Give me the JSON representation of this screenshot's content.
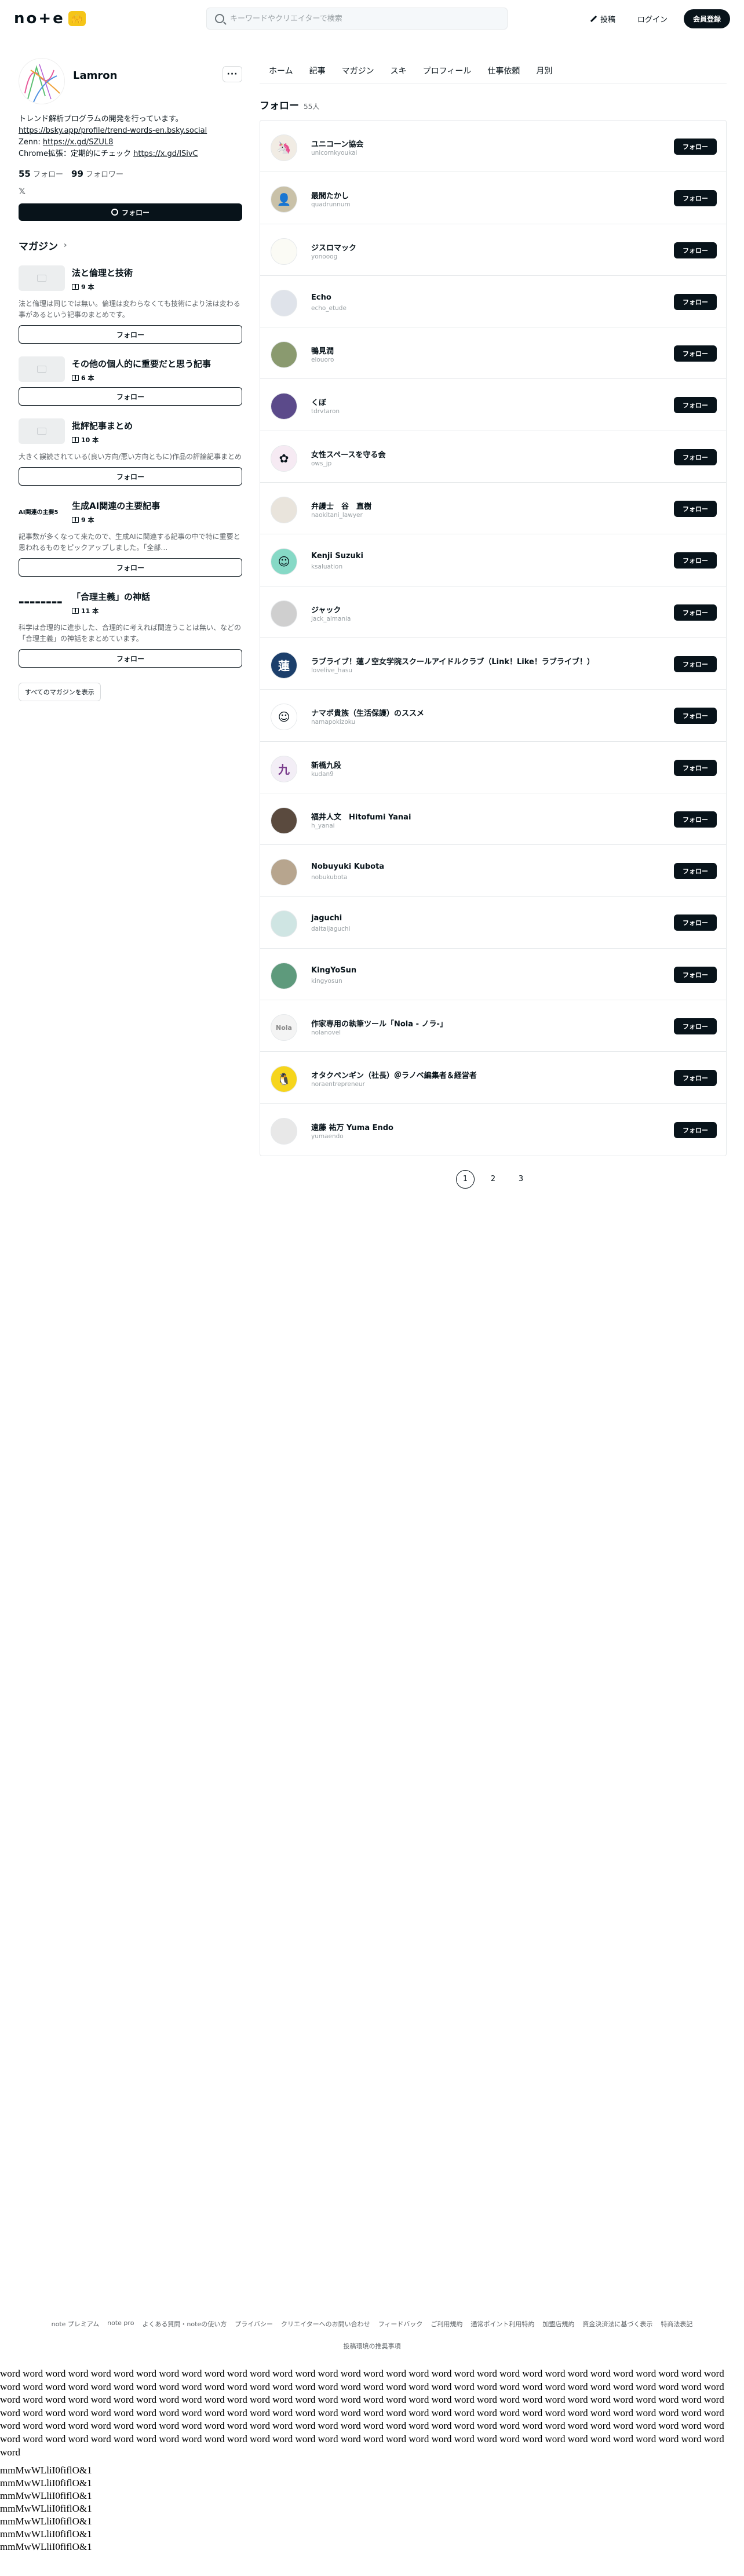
{
  "header": {
    "logo_text": "no+e",
    "search_placeholder": "キーワードやクリエイターで検索",
    "post_label": "投稿",
    "login_label": "ログイン",
    "signup_label": "会員登録"
  },
  "profile": {
    "name": "Lamron",
    "bio_line1": "トレンド解析プログラムの開発を行っています。",
    "bio_link1": "https://bsky.app/profile/trend-words-en.bsky.social",
    "bio_zenn_label": "Zenn: ",
    "bio_zenn_link": "https://x.gd/SZUL8",
    "bio_chrome_label": "Chrome拡張：定期的にチェック ",
    "bio_chrome_link": "https://x.gd/lSivC",
    "follow_count": "55",
    "follow_label": "フォロー",
    "follower_count": "99",
    "follower_label": "フォロワー",
    "x_label": "𝕏",
    "follow_button": "フォロー"
  },
  "magazines": {
    "heading": "マガジン",
    "items": [
      {
        "title": "法と倫理と技術",
        "count": "9 本",
        "desc": "法と倫理は同じでは無い。倫理は変わらなくても技術により法は変わる事があるという記事のまとめです。",
        "follow": "フォロー",
        "thumb": ""
      },
      {
        "title": "その他の個人的に重要だと思う記事",
        "count": "6 本",
        "desc": "",
        "follow": "フォロー",
        "thumb": ""
      },
      {
        "title": "批評記事まとめ",
        "count": "10 本",
        "desc": "大きく誤読されている(良い方向/悪い方向ともに)作品の評論記事まとめ",
        "follow": "フォロー",
        "thumb": ""
      },
      {
        "title": "生成AI関連の主要記事",
        "count": "9 本",
        "desc": "記事数が多くなって来たので、生成AIに関連する記事の中で特に重要と思われるものをピックアップしました。「全部…",
        "follow": "フォロー",
        "thumb": "AI関連の主要5"
      },
      {
        "title": "「合理主義」の神話",
        "count": "11 本",
        "desc": "科学は合理的に進歩した、合理的に考えれば間違うことは無い、などの「合理主義」の神話をまとめています。",
        "follow": "フォロー",
        "thumb": "▬▬▬▬▬▬▬▬"
      }
    ],
    "all_label": "すべてのマガジンを表示"
  },
  "tabs": [
    "ホーム",
    "記事",
    "マガジン",
    "スキ",
    "プロフィール",
    "仕事依頼",
    "月別"
  ],
  "follows": {
    "title": "フォロー",
    "count": "55人",
    "button_label": "フォロー",
    "users": [
      {
        "name": "ユニコーン協会",
        "handle": "unicornkyoukai",
        "avatar": "🦄",
        "bg": "#f1ece4"
      },
      {
        "name": "最間たかし",
        "handle": "quadrunnum",
        "avatar": "👤",
        "bg": "#c9c1a8"
      },
      {
        "name": "ジスロマック",
        "handle": "yonooog",
        "avatar": "",
        "bg": "#fbfbf5"
      },
      {
        "name": "Echo",
        "handle": "echo_etude",
        "avatar": "",
        "bg": "#dfe3ea"
      },
      {
        "name": "鴨見潤",
        "handle": "elouoro",
        "avatar": "",
        "bg": "#8a9a6f"
      },
      {
        "name": "くぼ",
        "handle": "tdrvtaron",
        "avatar": "",
        "bg": "#5b4a8a"
      },
      {
        "name": "女性スペースを守る会",
        "handle": "ows_jp",
        "avatar": "✿",
        "bg": "#f6eaf3"
      },
      {
        "name": "弁護士　谷　直樹",
        "handle": "naokitani_lawyer",
        "avatar": "",
        "bg": "#e9e4dc"
      },
      {
        "name": "Kenji Suzuki",
        "handle": "ksaluation",
        "avatar": "☺",
        "bg": "#86d9c6"
      },
      {
        "name": "ジャック",
        "handle": "jack_almania",
        "avatar": "",
        "bg": "#cfcfcf"
      },
      {
        "name": "ラブライブ！蓮ノ空女学院スクールアイドルクラブ（Link！Like！ラブライブ！）",
        "handle": "lovelive_hasu",
        "avatar": "蓮",
        "bg": "#1c3f6b"
      },
      {
        "name": "ナマポ貴族（生活保護）のススメ",
        "handle": "namapokizoku",
        "avatar": "☺",
        "bg": "#ffffff"
      },
      {
        "name": "新橋九段",
        "handle": "kudan9",
        "avatar": "九",
        "bg": "#f3eef6"
      },
      {
        "name": "福井人文　Hitofumi Yanai",
        "handle": "h_yanai",
        "avatar": "",
        "bg": "#5a4a3e"
      },
      {
        "name": "Nobuyuki Kubota",
        "handle": "nobukubota",
        "avatar": "",
        "bg": "#b7a58e"
      },
      {
        "name": "jaguchi",
        "handle": "daitaijaguchi",
        "avatar": "",
        "bg": "#cfe5e3"
      },
      {
        "name": "KingYoSun",
        "handle": "kingyosun",
        "avatar": "",
        "bg": "#5e9a7c"
      },
      {
        "name": "作家専用の執筆ツール「Nola - ノラ-」",
        "handle": "nolanovel",
        "avatar": "Nola",
        "bg": "#f4f4f4"
      },
      {
        "name": "オタクペンギン（社長）＠ラノベ編集者＆経営者",
        "handle": "noraentrepreneur",
        "avatar": "🐧",
        "bg": "#f6d51c"
      },
      {
        "name": "遠藤 祐万 Yuma Endo",
        "handle": "yumaendo",
        "avatar": "",
        "bg": "#e8e8e8"
      }
    ]
  },
  "pager": [
    "1",
    "2",
    "3"
  ],
  "footer": {
    "links": [
      "note プレミアム",
      "note pro",
      "よくある質問・noteの使い方",
      "プライバシー",
      "クリエイターへのお問い合わせ",
      "フィードバック",
      "ご利用規約",
      "通常ポイント利用特約",
      "加盟店規約",
      "資金決済法に基づく表示",
      "特商法表記"
    ],
    "line2": "投稿環境の推奨事項"
  },
  "test_text": {
    "filler": "word word word word word word word word word word word word word word word word word word word word word word word word word word word word word word word word word word word word word word word word word word word word word word word word word word word word word word word word word word word word word word word word word word word word word word word word word word word word word word word word word word word word word word word word word word word word word word word word word word word word word word word word word word word word word word word word word word word word word word word word word word word word word word word word word word word word word word word word word word word word word word word word word word word word word word word word word word word word word word word word word word word word word word word word word word word word word word word word word word word word word word word word word word word word word word word word word",
    "lines": [
      "mmMwWLliI0fiflO&1",
      "mmMwWLliI0fiflO&1",
      "mmMwWLliI0fiflO&1",
      "mmMwWLliI0fiflO&1",
      "mmMwWLliI0fiflO&1",
      "mmMwWLliI0fiflO&1",
      "mmMwWLliI0fiflO&1"
    ]
  }
}
